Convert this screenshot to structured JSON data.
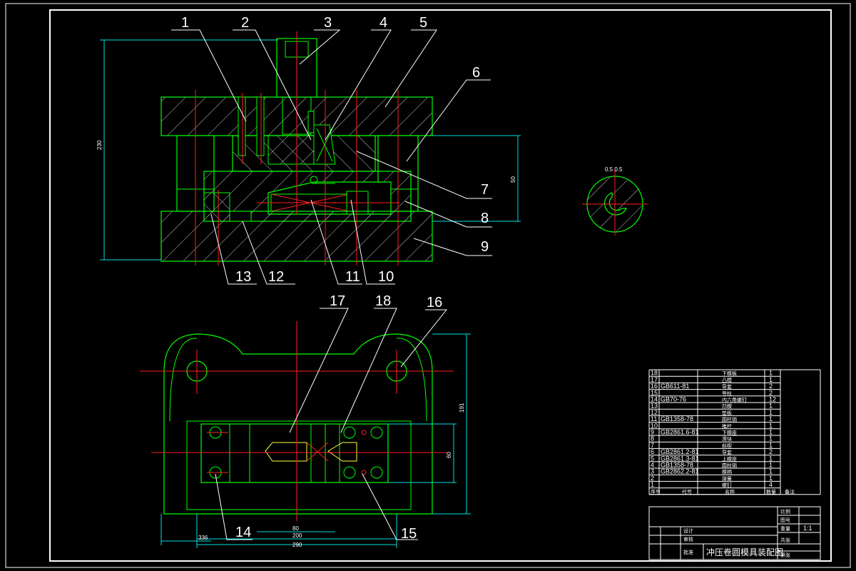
{
  "title": "冲压卷圆模具装配图",
  "part_numbers": [
    "1",
    "2",
    "3",
    "4",
    "5",
    "6",
    "7",
    "8",
    "9",
    "10",
    "11",
    "12",
    "13",
    "14",
    "15",
    "16",
    "17",
    "18"
  ],
  "dimensions": {
    "overall_height": "230",
    "shut_height": "50",
    "detail_dims": "0.5  0.5",
    "plan_depth": "191",
    "plan_inner": "60",
    "plan_w1": "80",
    "plan_w2": "200",
    "plan_w3": "290",
    "plan_w4": "336"
  },
  "bom": {
    "rows": [
      {
        "no": "18",
        "code": "",
        "name": "下模板",
        "qty": "1"
      },
      {
        "no": "17",
        "code": "",
        "name": "凸模",
        "qty": "1"
      },
      {
        "no": "16",
        "code": "GB611-81",
        "name": "导套",
        "qty": "2"
      },
      {
        "no": "15",
        "code": "",
        "name": "导柱",
        "qty": "2"
      },
      {
        "no": "14",
        "code": "GB70-76",
        "name": "内六角螺钉",
        "qty": "12"
      },
      {
        "no": "13",
        "code": "",
        "name": "凹模",
        "qty": "1"
      },
      {
        "no": "12",
        "code": "",
        "name": "垫板",
        "qty": "1"
      },
      {
        "no": "11",
        "code": "GB1358-78",
        "name": "圆柱销",
        "qty": "1"
      },
      {
        "no": "10",
        "code": "",
        "name": "推杆",
        "qty": "1"
      },
      {
        "no": "9",
        "code": "GB2861.6-81",
        "name": "下模座",
        "qty": "1"
      },
      {
        "no": "8",
        "code": "",
        "name": "滑块",
        "qty": "1"
      },
      {
        "no": "7",
        "code": "",
        "name": "斜楔",
        "qty": "1"
      },
      {
        "no": "6",
        "code": "GB2861.2-81",
        "name": "导套",
        "qty": "2"
      },
      {
        "no": "5",
        "code": "GB2861.3-81",
        "name": "上模座",
        "qty": "1"
      },
      {
        "no": "4",
        "code": "GB1358-78",
        "name": "圆柱销",
        "qty": "1"
      },
      {
        "no": "3",
        "code": "GB2862.2-81",
        "name": "模柄",
        "qty": "1"
      },
      {
        "no": "2",
        "code": "",
        "name": "弹簧",
        "qty": "1"
      },
      {
        "no": "1",
        "code": "",
        "name": "螺钉",
        "qty": "4"
      }
    ],
    "header": {
      "no": "序号",
      "code": "代号",
      "name": "名称",
      "qty": "数量",
      "remark": "备注"
    }
  },
  "title_block": {
    "scale": "1:1",
    "r1": "比例",
    "r2": "图号",
    "r3": "重量",
    "r4": "共张",
    "r5": "第张",
    "designer": "设计",
    "checker": "审核",
    "approve": "批准"
  },
  "colors": {
    "outline": "#00ff00",
    "center": "#ff2020",
    "hatch": "#c8c8c8",
    "dimension": "#00e0e0",
    "label": "#ffffff",
    "frame": "#ffffff"
  }
}
